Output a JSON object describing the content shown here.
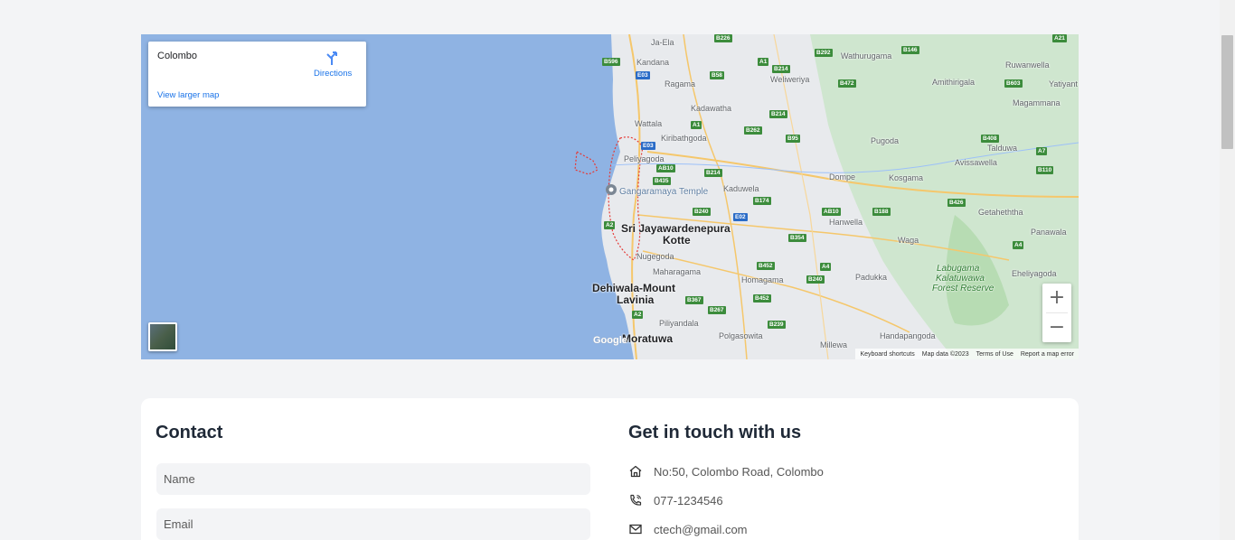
{
  "map": {
    "place_title": "Colombo",
    "directions_label": "Directions",
    "larger_map_link": "View larger map",
    "google_logo": "Google",
    "zoom_in": "+",
    "zoom_out": "−",
    "footer": {
      "shortcuts": "Keyboard shortcuts",
      "map_data": "Map data ©2023",
      "terms": "Terms of Use",
      "report": "Report a map error"
    },
    "labels": {
      "jaela": "Ja-Ela",
      "wathurugama": "Wathurugama",
      "ruwanwella": "Ruwanwella",
      "kandana": "Kandana",
      "weliweriya": "Weliweriya",
      "amithirigala": "Amithirigala",
      "yatiyant": "Yatiyant",
      "ragama": "Ragama",
      "kadawatha": "Kadawatha",
      "magammana": "Magammana",
      "wattala": "Wattala",
      "kiribathgoda": "Kiribathgoda",
      "pugoda": "Pugoda",
      "peliyagoda": "Peliyagoda",
      "talduwa": "Talduwa",
      "avissawella": "Avissawella",
      "dompe": "Dompe",
      "kosgama": "Kosgama",
      "gangaramaya": "Gangaramaya Temple",
      "kaduwela": "Kaduwela",
      "getaheththa": "Getaheththa",
      "hanwella": "Hanwella",
      "sri_jaya": "Sri Jayawardenepura",
      "kotte": "Kotte",
      "waga": "Waga",
      "panawala": "Panawala",
      "nugegoda": "Nugegoda",
      "labugama": "Labugama",
      "kalatuwawa": "Kalatuwawa",
      "forest_reserve": "Forest Reserve",
      "maharagama": "Maharagama",
      "padukka": "Padukka",
      "eheliyagoda": "Eheliyagoda",
      "homagama": "Homagama",
      "dehiwala": "Dehiwala-Mount",
      "lavinia": "Lavinia",
      "piliyandala": "Piliyandala",
      "polgasowita": "Polgasowita",
      "handapangoda": "Handapangoda",
      "moratuwa": "Moratuwa",
      "millewa": "Millewa"
    },
    "badges": {
      "b226": "B226",
      "b146": "B146",
      "a21": "A21",
      "b596": "B596",
      "a1": "A1",
      "b214": "B214",
      "b292": "B292",
      "e03": "E03",
      "b58": "B58",
      "b472": "B472",
      "b603": "B603",
      "b214b": "B214",
      "b262": "B262",
      "b95": "B95",
      "e03b": "E03",
      "a1b": "A1",
      "b408": "B408",
      "a7": "A7",
      "ab10": "AB10",
      "b214c": "B214",
      "b110": "B110",
      "b435": "B435",
      "b174": "B174",
      "b426": "B426",
      "b240": "B240",
      "e02": "E02",
      "ab10b": "AB10",
      "b188": "B188",
      "a2": "A2",
      "b354": "B354",
      "a4": "A4",
      "b452": "B452",
      "a4b": "A4",
      "b240b": "B240",
      "b367": "B367",
      "b452b": "B452",
      "b267": "B267",
      "a2b": "A2",
      "b239": "B239"
    }
  },
  "contact": {
    "title": "Contact",
    "name_placeholder": "Name",
    "email_placeholder": "Email"
  },
  "get_in_touch": {
    "title": "Get in touch with us",
    "address": "No:50, Colombo Road, Colombo",
    "phone": "077-1234546",
    "email": "ctech@gmail.com"
  }
}
